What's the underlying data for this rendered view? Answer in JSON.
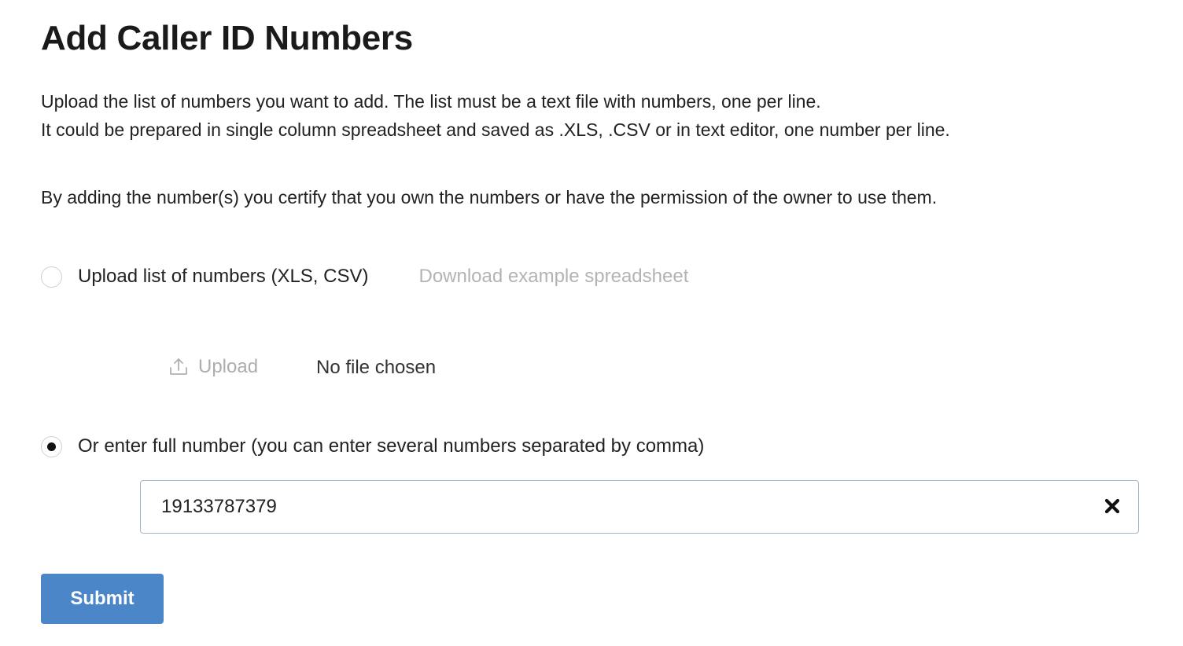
{
  "page": {
    "title": "Add Caller ID Numbers",
    "description_line_1": "Upload the list of numbers you want to add. The list must be a text file with numbers, one per line.",
    "description_line_2": "It could be prepared in single column spreadsheet and saved as .XLS, .CSV or in text editor, one number per line.",
    "certification_text": "By adding the number(s) you certify that you own the numbers or have the permission of the owner to use them."
  },
  "upload_option": {
    "label": "Upload list of numbers (XLS, CSV)",
    "selected": false,
    "download_link_label": "Download example spreadsheet",
    "upload_button_label": "Upload",
    "upload_icon": "upload-icon",
    "file_status": "No file chosen"
  },
  "manual_option": {
    "label": "Or enter full number (you can enter several numbers separated by comma)",
    "selected": true,
    "input_value": "19133787379",
    "clear_icon": "close-icon"
  },
  "actions": {
    "submit_label": "Submit"
  },
  "colors": {
    "submit_background": "#4a86c8",
    "muted_text": "#b3b3b3",
    "input_border": "#9fb8cc"
  }
}
